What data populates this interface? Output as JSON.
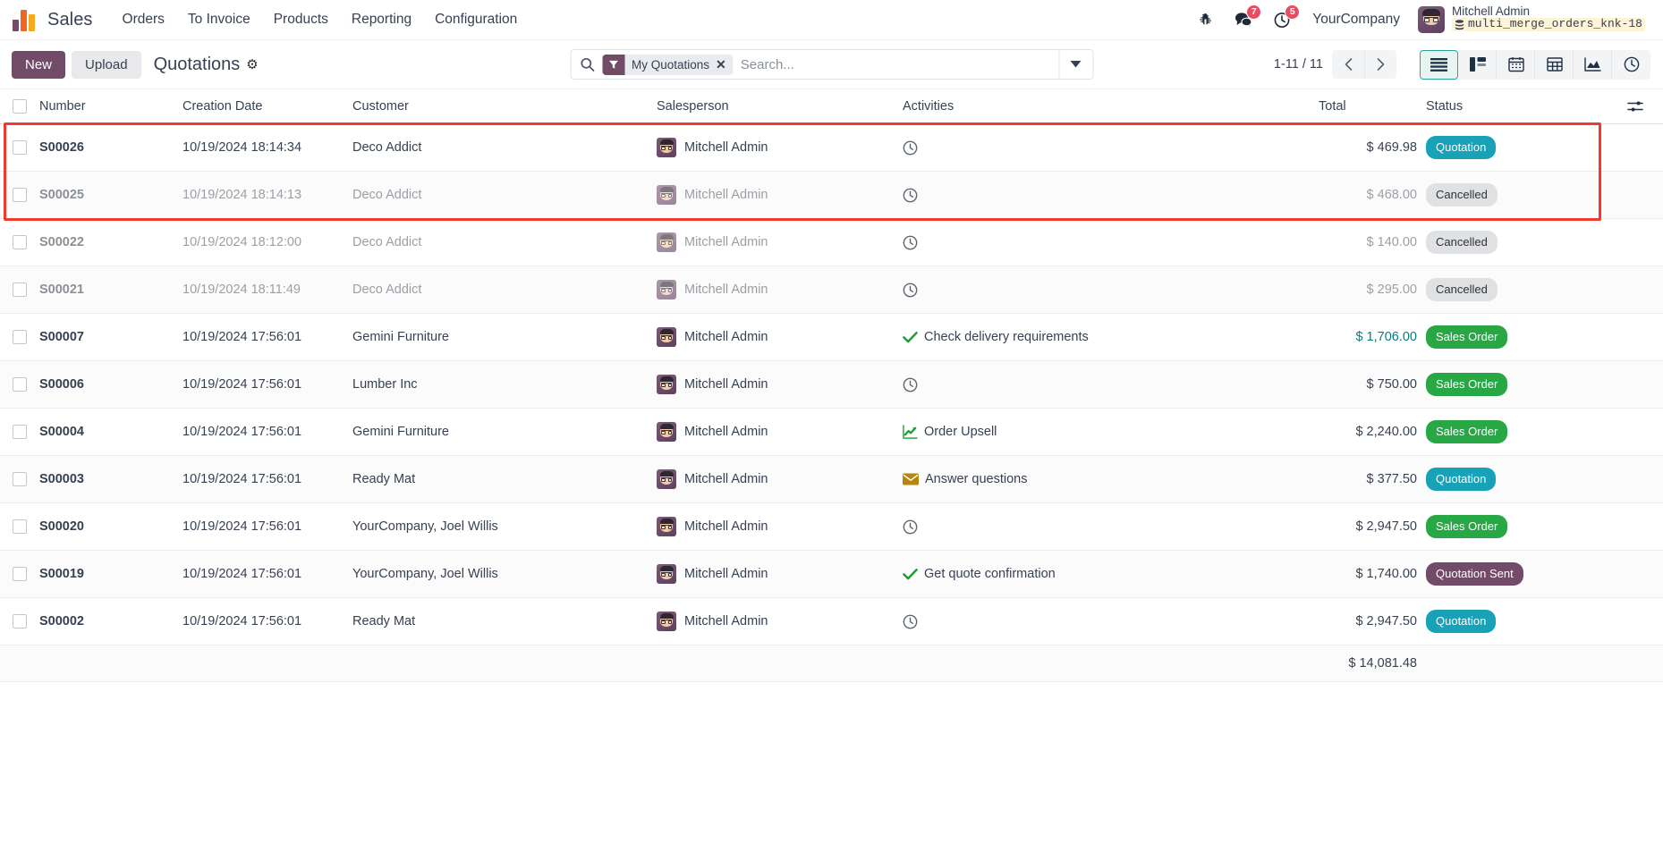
{
  "navbar": {
    "brand": "Sales",
    "menus": [
      "Orders",
      "To Invoice",
      "Products",
      "Reporting",
      "Configuration"
    ],
    "systray": {
      "bug_icon": "bug-icon",
      "messages_icon": "messages-icon",
      "messages_count": "7",
      "activities_icon": "activities-clock-icon",
      "activities_count": "5"
    },
    "company": "YourCompany",
    "user": {
      "name": "Mitchell Admin",
      "database": "multi_merge_orders_knk-18",
      "db_icon": "database-icon"
    }
  },
  "control_panel": {
    "new_label": "New",
    "upload_label": "Upload",
    "title": "Quotations",
    "gear_icon": "gear-icon",
    "search": {
      "search_icon": "search-icon",
      "facet_icon": "filter-icon",
      "facet_label": "My Quotations",
      "facet_remove_icon": "close-icon",
      "placeholder": "Search...",
      "value": "",
      "dropdown_icon": "chevron-down-icon"
    },
    "pager": {
      "range": "1-11 / 11",
      "prev_icon": "chevron-left-icon",
      "next_icon": "chevron-right-icon"
    },
    "views": [
      {
        "name": "list",
        "icon": "list-icon",
        "active": true
      },
      {
        "name": "kanban",
        "icon": "kanban-icon",
        "active": false
      },
      {
        "name": "calendar",
        "icon": "calendar-icon",
        "active": false
      },
      {
        "name": "pivot",
        "icon": "pivot-icon",
        "active": false
      },
      {
        "name": "graph",
        "icon": "graph-icon",
        "active": false
      },
      {
        "name": "activity",
        "icon": "clock-icon",
        "active": false
      }
    ]
  },
  "list": {
    "columns": {
      "number": "Number",
      "creation_date": "Creation Date",
      "customer": "Customer",
      "salesperson": "Salesperson",
      "activities": "Activities",
      "total": "Total",
      "status": "Status"
    },
    "optional_columns_icon": "sliders-icon",
    "select_all_checkbox": "checkbox",
    "rows": [
      {
        "number": "S00026",
        "date": "10/19/2024 18:14:34",
        "customer": "Deco Addict",
        "salesperson": "Mitchell Admin",
        "activity_icon": "clock-icon",
        "activity": "",
        "total": "$ 469.98",
        "total_link": false,
        "status": "Quotation",
        "status_kind": "quotation",
        "muted": false,
        "highlighted": true
      },
      {
        "number": "S00025",
        "date": "10/19/2024 18:14:13",
        "customer": "Deco Addict",
        "salesperson": "Mitchell Admin",
        "activity_icon": "clock-icon",
        "activity": "",
        "total": "$ 468.00",
        "total_link": false,
        "status": "Cancelled",
        "status_kind": "cancelled",
        "muted": true,
        "highlighted": true
      },
      {
        "number": "S00022",
        "date": "10/19/2024 18:12:00",
        "customer": "Deco Addict",
        "salesperson": "Mitchell Admin",
        "activity_icon": "clock-icon",
        "activity": "",
        "total": "$ 140.00",
        "total_link": false,
        "status": "Cancelled",
        "status_kind": "cancelled",
        "muted": true,
        "highlighted": false
      },
      {
        "number": "S00021",
        "date": "10/19/2024 18:11:49",
        "customer": "Deco Addict",
        "salesperson": "Mitchell Admin",
        "activity_icon": "clock-icon",
        "activity": "",
        "total": "$ 295.00",
        "total_link": false,
        "status": "Cancelled",
        "status_kind": "cancelled",
        "muted": true,
        "highlighted": false
      },
      {
        "number": "S00007",
        "date": "10/19/2024 17:56:01",
        "customer": "Gemini Furniture",
        "salesperson": "Mitchell Admin",
        "activity_icon": "check-icon",
        "activity": "Check delivery requirements",
        "total": "$ 1,706.00",
        "total_link": true,
        "status": "Sales Order",
        "status_kind": "sales",
        "muted": false,
        "highlighted": false
      },
      {
        "number": "S00006",
        "date": "10/19/2024 17:56:01",
        "customer": "Lumber Inc",
        "salesperson": "Mitchell Admin",
        "activity_icon": "clock-icon",
        "activity": "",
        "total": "$ 750.00",
        "total_link": false,
        "status": "Sales Order",
        "status_kind": "sales",
        "muted": false,
        "highlighted": false
      },
      {
        "number": "S00004",
        "date": "10/19/2024 17:56:01",
        "customer": "Gemini Furniture",
        "salesperson": "Mitchell Admin",
        "activity_icon": "upsell-chart-icon",
        "activity": "Order Upsell",
        "total": "$ 2,240.00",
        "total_link": false,
        "status": "Sales Order",
        "status_kind": "sales",
        "muted": false,
        "highlighted": false
      },
      {
        "number": "S00003",
        "date": "10/19/2024 17:56:01",
        "customer": "Ready Mat",
        "salesperson": "Mitchell Admin",
        "activity_icon": "envelope-icon",
        "activity": "Answer questions",
        "total": "$ 377.50",
        "total_link": false,
        "status": "Quotation",
        "status_kind": "quotation",
        "muted": false,
        "highlighted": false
      },
      {
        "number": "S00020",
        "date": "10/19/2024 17:56:01",
        "customer": "YourCompany, Joel Willis",
        "salesperson": "Mitchell Admin",
        "activity_icon": "clock-icon",
        "activity": "",
        "total": "$ 2,947.50",
        "total_link": false,
        "status": "Sales Order",
        "status_kind": "sales",
        "muted": false,
        "highlighted": false
      },
      {
        "number": "S00019",
        "date": "10/19/2024 17:56:01",
        "customer": "YourCompany, Joel Willis",
        "salesperson": "Mitchell Admin",
        "activity_icon": "check-icon",
        "activity": "Get quote confirmation",
        "total": "$ 1,740.00",
        "total_link": false,
        "status": "Quotation Sent",
        "status_kind": "sent",
        "muted": false,
        "highlighted": false
      },
      {
        "number": "S00002",
        "date": "10/19/2024 17:56:01",
        "customer": "Ready Mat",
        "salesperson": "Mitchell Admin",
        "activity_icon": "clock-icon",
        "activity": "",
        "total": "$ 2,947.50",
        "total_link": false,
        "status": "Quotation",
        "status_kind": "quotation",
        "muted": false,
        "highlighted": false
      }
    ],
    "footer_total": "$ 14,081.48"
  },
  "colors": {
    "brand_purple": "#714B67",
    "quotation": "#17a2b8",
    "sales_order": "#28a745",
    "quotation_sent": "#714B67",
    "cancelled": "#dfe1e3",
    "highlight_red": "#f03a2f",
    "badge_red": "#e74c62"
  }
}
